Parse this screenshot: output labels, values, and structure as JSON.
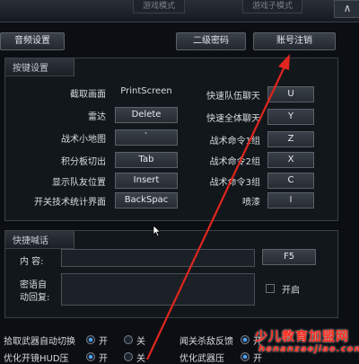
{
  "top_tabs": [
    "游戏模式",
    "游戏子模式"
  ],
  "corner_button": "∧",
  "toolbar": {
    "audio_settings": "音频设置",
    "secondary_password": "二级密码",
    "account_logout": "账号注销"
  },
  "hotkeys": {
    "title": "按键设置",
    "left": [
      {
        "label": "截取画面",
        "key": "PrintScreen"
      },
      {
        "label": "雷达",
        "key": "Delete"
      },
      {
        "label": "战术小地图",
        "key": "`"
      },
      {
        "label": "积分板切出",
        "key": "Tab"
      },
      {
        "label": "显示队友位置",
        "key": "Insert"
      },
      {
        "label": "开关技术统计界面",
        "key": "BackSpac"
      }
    ],
    "right": [
      {
        "label": "快速队伍聊天",
        "key": "U"
      },
      {
        "label": "快速全体聊天",
        "key": "Y"
      },
      {
        "label": "战术命令1组",
        "key": "Z"
      },
      {
        "label": "战术命令2组",
        "key": "X"
      },
      {
        "label": "战术命令3组",
        "key": "C"
      },
      {
        "label": "喷漆",
        "key": "I"
      }
    ]
  },
  "quick_chat": {
    "title": "快捷喊话",
    "content_label": "内    容:",
    "key": "F5",
    "auto_reply_label_1": "密语自",
    "auto_reply_label_2": "动回复:",
    "enable_label": "开启"
  },
  "bottom_options": {
    "row1": {
      "left_label": "拾取武器自动切换",
      "left_on": "开",
      "left_off": "关",
      "right_label": "闻关杀敌反馈",
      "right_on": "开"
    },
    "row2": {
      "left_label": "优化开镜HUD压",
      "left_on": "开",
      "left_off": "关",
      "right_label": "优化武器压",
      "right_on": "开"
    }
  },
  "watermark": {
    "cn": "少儿教育加盟网",
    "url": "henanzaojiao.com"
  },
  "colors": {
    "background": "#0b0f14",
    "panel": "#12171c",
    "arrow": "#e0261e",
    "radio_selected": "#4aa6ff",
    "watermark": "#ff2a1a"
  }
}
